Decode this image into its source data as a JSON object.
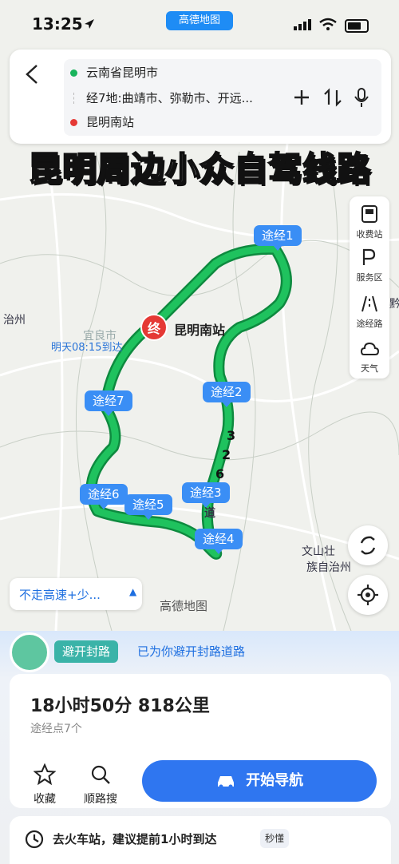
{
  "status_bar": {
    "time": "13:25",
    "app_badge": "高德地图"
  },
  "route": {
    "origin": "云南省昆明市",
    "waypoints_summary": "经7地:曲靖市、弥勒市、开远...",
    "destination": "昆明南站"
  },
  "overlay_title": "昆明周边小众自驾线路",
  "tools": [
    {
      "label": "收费站",
      "icon": "toll-station-icon"
    },
    {
      "label": "服务区",
      "icon": "service-area-icon"
    },
    {
      "label": "途经路",
      "icon": "via-road-icon"
    },
    {
      "label": "天气",
      "icon": "weather-icon"
    }
  ],
  "map": {
    "end_marker": "终",
    "end_label": "昆明南站",
    "arrival": "明天08:15到达",
    "waypoints": [
      "途经1",
      "途经2",
      "途经3",
      "途经4",
      "途经5",
      "途经6",
      "途经7"
    ],
    "place_labels": [
      "治州",
      "宜良市",
      "文山壮",
      "族自治州",
      "黔",
      "道"
    ],
    "road_numbers": [
      "3",
      "2",
      "6"
    ],
    "watermark": "高德地图",
    "route_color": "#18b957"
  },
  "avoid_option": {
    "label": "不走高速+少...",
    "chevron": "▲"
  },
  "bottom": {
    "avoid_tag": "避开封路",
    "avoid_desc": "已为你避开封路道路",
    "duration_distance": "18小时50分  818公里",
    "waypoint_count": "途经点7个",
    "favorite_label": "收藏",
    "search_along_label": "顺路搜",
    "navigate_label": "开始导航",
    "notice_text": "去火车站，建议提前1小时到达",
    "notice_badge": "秒懂"
  },
  "colors": {
    "accent": "#2f76f0",
    "route": "#18b957",
    "waypoint": "#3a8ef5"
  }
}
